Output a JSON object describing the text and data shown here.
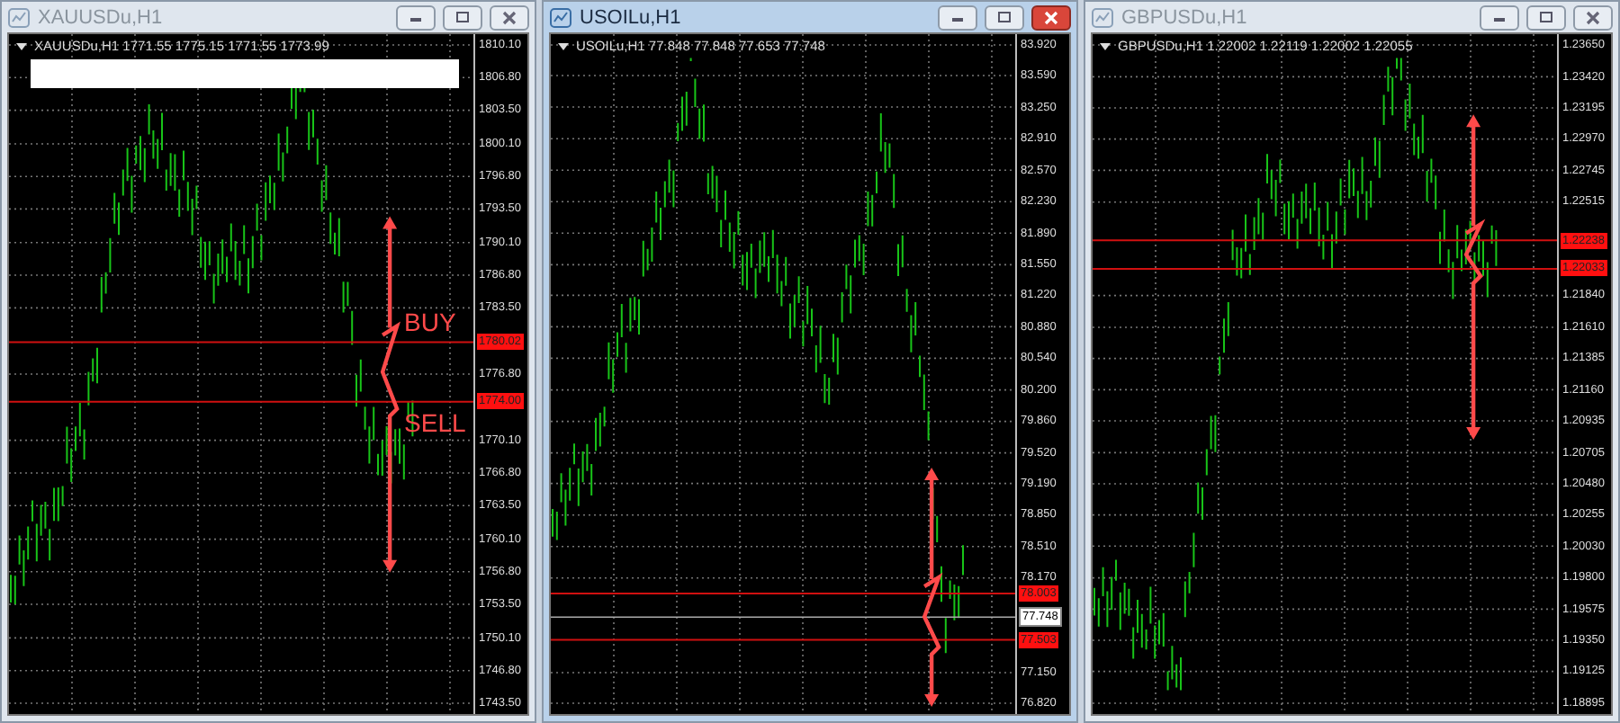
{
  "windows": [
    {
      "title": "XAUUSDu,H1",
      "active": false,
      "symbol_line": "XAUUSDu,H1  1771.55 1775.15 1771.55 1773.99",
      "blank_label": true,
      "ticks": [
        "1810.10",
        "1806.80",
        "1803.50",
        "1800.10",
        "1796.80",
        "1793.50",
        "1790.10",
        "1786.80",
        "1783.50",
        "1776.80",
        "1770.10",
        "1766.80",
        "1763.50",
        "1760.10",
        "1756.80",
        "1753.50",
        "1750.10",
        "1746.80",
        "1743.50"
      ],
      "levels": [
        {
          "price": "1780.02",
          "kind": "order",
          "label": "BUY"
        },
        {
          "price": "1774.00",
          "kind": "order",
          "label": "SELL"
        }
      ]
    },
    {
      "title": "USOILu,H1",
      "active": true,
      "symbol_line": "USOILu,H1  77.848 77.848 77.653 77.748",
      "ticks": [
        "83.920",
        "83.590",
        "83.250",
        "82.910",
        "82.570",
        "82.230",
        "81.890",
        "81.550",
        "81.220",
        "80.880",
        "80.540",
        "80.200",
        "79.860",
        "79.520",
        "79.190",
        "78.850",
        "78.510",
        "78.170",
        "77.150",
        "76.820"
      ],
      "levels": [
        {
          "price": "78.003",
          "kind": "order"
        },
        {
          "price": "77.748",
          "kind": "current"
        },
        {
          "price": "77.503",
          "kind": "order"
        }
      ]
    },
    {
      "title": "GBPUSDu,H1",
      "active": false,
      "symbol_line": "GBPUSDu,H1  1.22002 1.22119 1.22002 1.22055",
      "ticks": [
        "1.23650",
        "1.23420",
        "1.23195",
        "1.22970",
        "1.22745",
        "1.22515",
        "1.21840",
        "1.21610",
        "1.21385",
        "1.21160",
        "1.20935",
        "1.20705",
        "1.20480",
        "1.20255",
        "1.20030",
        "1.19800",
        "1.19575",
        "1.19350",
        "1.19125",
        "1.18895"
      ],
      "levels": [
        {
          "price": "1.22238",
          "kind": "order"
        },
        {
          "price": "1.22033",
          "kind": "order"
        }
      ]
    }
  ]
}
